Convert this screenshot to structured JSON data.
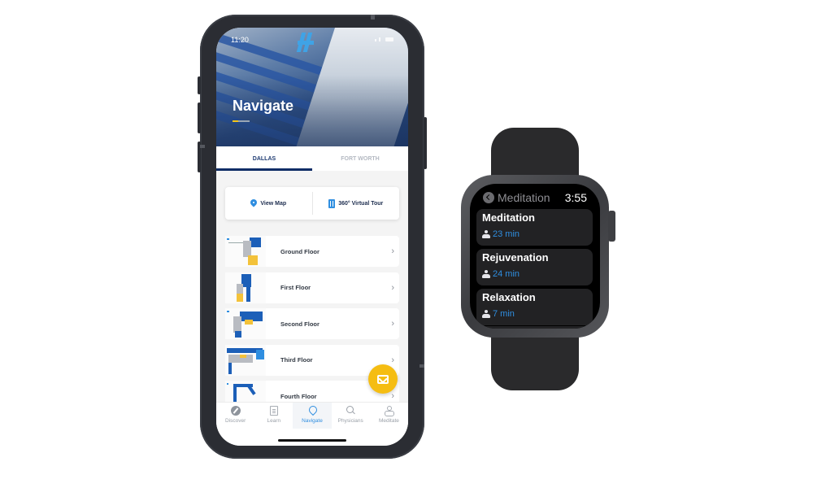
{
  "phone": {
    "status_bar": {
      "time": "11:20"
    },
    "hero": {
      "title": "Navigate"
    },
    "tabs": [
      {
        "label": "DALLAS",
        "active": true
      },
      {
        "label": "FORT WORTH",
        "active": false
      }
    ],
    "actions": [
      {
        "label": "View Map",
        "icon": "map-pin-icon"
      },
      {
        "label": "360° Virtual Tour",
        "icon": "building-icon"
      }
    ],
    "floors": [
      {
        "label": "Ground Floor"
      },
      {
        "label": "First Floor"
      },
      {
        "label": "Second Floor"
      },
      {
        "label": "Third Floor"
      },
      {
        "label": "Fourth Floor"
      }
    ],
    "fab": {
      "icon": "phone-message-icon"
    },
    "bottom_nav": [
      {
        "label": "Discover",
        "icon": "compass-icon",
        "active": false
      },
      {
        "label": "Learn",
        "icon": "document-icon",
        "active": false
      },
      {
        "label": "Navigate",
        "icon": "location-pin-icon",
        "active": true
      },
      {
        "label": "Physicians",
        "icon": "search-icon",
        "active": false
      },
      {
        "label": "Meditate",
        "icon": "meditate-icon",
        "active": false
      }
    ]
  },
  "watch": {
    "header": {
      "title": "Meditation",
      "time": "3:55"
    },
    "sessions": [
      {
        "name": "Meditation",
        "duration": "23 min"
      },
      {
        "name": "Rejuvenation",
        "duration": "24 min"
      },
      {
        "name": "Relaxation",
        "duration": "7 min"
      }
    ]
  },
  "colors": {
    "brand_navy": "#0f2d66",
    "accent_blue": "#2f8ee0",
    "fab_yellow": "#f5bd12",
    "watch_card": "#222224"
  }
}
